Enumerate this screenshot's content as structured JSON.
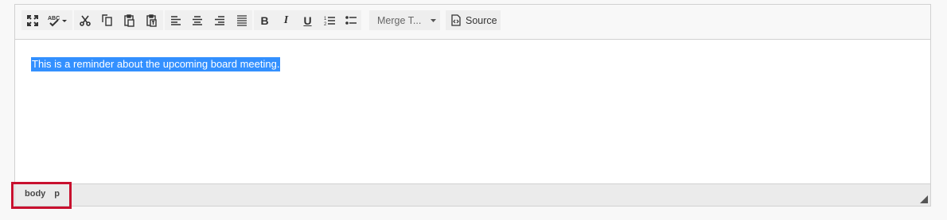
{
  "toolbar": {
    "buttons": [
      {
        "name": "maximize-button",
        "icon": "maximize-icon"
      },
      {
        "name": "spellcheck-button",
        "icon": "spellcheck-icon",
        "icon_text": "ABC"
      },
      {
        "name": "cut-button",
        "icon": "scissors-icon"
      },
      {
        "name": "copy-button",
        "icon": "copy-icon"
      },
      {
        "name": "paste-button",
        "icon": "paste-icon"
      },
      {
        "name": "paste-text-button",
        "icon": "paste-text-icon"
      },
      {
        "name": "align-left-button",
        "icon": "align-left-icon"
      },
      {
        "name": "align-center-button",
        "icon": "align-center-icon"
      },
      {
        "name": "align-right-button",
        "icon": "align-right-icon"
      },
      {
        "name": "align-justify-button",
        "icon": "align-justify-icon"
      },
      {
        "name": "bold-button",
        "icon": "bold-icon",
        "icon_text": "B"
      },
      {
        "name": "italic-button",
        "icon": "italic-icon",
        "icon_text": "I"
      },
      {
        "name": "underline-button",
        "icon": "underline-icon",
        "icon_text": "U"
      },
      {
        "name": "numbered-list-button",
        "icon": "numbered-list-icon"
      },
      {
        "name": "bulleted-list-button",
        "icon": "bulleted-list-icon"
      }
    ],
    "merge_tags": {
      "label": "Merge T...",
      "icon": "chevron-down-icon"
    },
    "source": {
      "label": "Source",
      "icon": "source-icon"
    }
  },
  "content": {
    "text": "This is a reminder about the upcoming board meeting.",
    "selected": true
  },
  "statusbar": {
    "path": [
      "body",
      "p"
    ],
    "resize_icon": "resize-handle-icon"
  },
  "colors": {
    "selection": "#3390ff",
    "highlight_border": "#c8102e",
    "toolbar_bg": "#f8f8f8",
    "statusbar_bg": "#ebebeb"
  }
}
